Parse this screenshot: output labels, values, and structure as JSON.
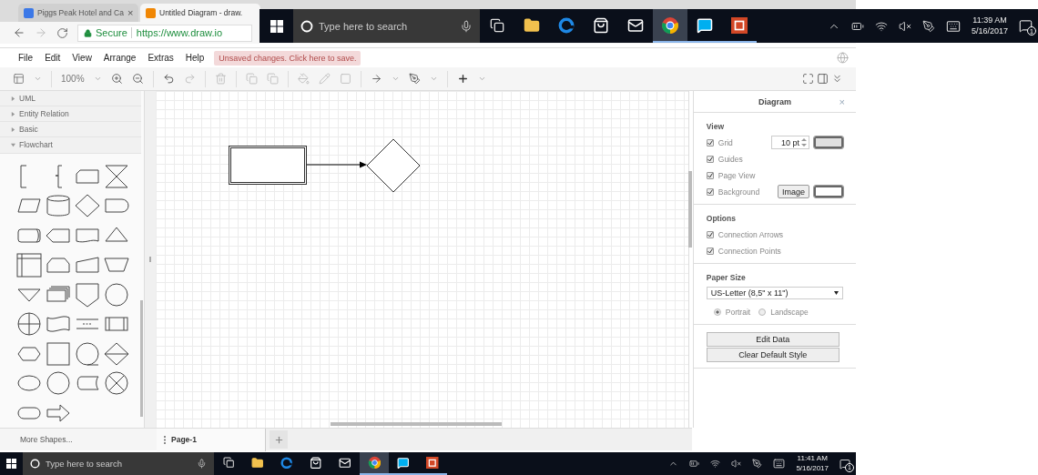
{
  "browser": {
    "tabs": [
      {
        "title": "Piggs Peak Hotel and Ca",
        "close": "×",
        "selected": false
      },
      {
        "title": "Untitled Diagram - draw.",
        "selected": true
      }
    ],
    "secure_label": "Secure",
    "url": "https://www.draw.io"
  },
  "menu": [
    "File",
    "Edit",
    "View",
    "Arrange",
    "Extras",
    "Help"
  ],
  "unsaved_notice": "Unsaved changes. Click here to save.",
  "toolbar": {
    "zoom": "100%"
  },
  "sidebar": {
    "sections": [
      {
        "label": "UML",
        "expanded": false
      },
      {
        "label": "Entity Relation",
        "expanded": false
      },
      {
        "label": "Basic",
        "expanded": false
      },
      {
        "label": "Flowchart",
        "expanded": true
      }
    ],
    "more_shapes": "More Shapes..."
  },
  "format_panel": {
    "title": "Diagram",
    "close": "×",
    "view": {
      "heading": "View",
      "options": [
        {
          "label": "Grid",
          "checked": true,
          "kind": "grid",
          "value": "10 pt",
          "color": "#e0e0e0"
        },
        {
          "label": "Guides",
          "checked": true,
          "kind": "plain"
        },
        {
          "label": "Page View",
          "checked": true,
          "kind": "plain"
        },
        {
          "label": "Background",
          "checked": true,
          "kind": "background",
          "button": "Image",
          "color": "#ffffff"
        }
      ]
    },
    "options": {
      "heading": "Options",
      "options": [
        {
          "label": "Connection Arrows",
          "checked": true
        },
        {
          "label": "Connection Points",
          "checked": true
        }
      ]
    },
    "paper": {
      "heading": "Paper Size",
      "value": "US-Letter (8,5\" x 11\")",
      "orientations": [
        {
          "label": "Portrait",
          "selected": true
        },
        {
          "label": "Landscape",
          "selected": false
        }
      ]
    },
    "buttons": [
      "Edit Data",
      "Clear Default Style"
    ]
  },
  "pages": [
    {
      "label": "Page-1",
      "selected": true
    }
  ],
  "taskbars": [
    {
      "search_placeholder": "Type here to search",
      "time": "11:39 AM",
      "date": "5/16/2017",
      "notifications": "1"
    },
    {
      "search_placeholder": "Type here to search",
      "time": "11:41 AM",
      "date": "5/16/2017",
      "notifications": "1"
    }
  ]
}
